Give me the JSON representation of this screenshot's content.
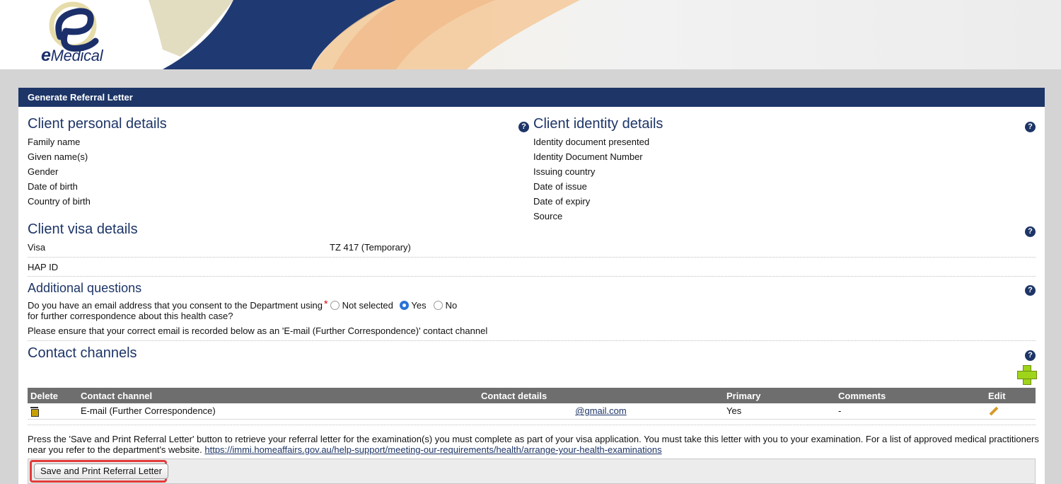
{
  "brand": {
    "logo_text_e": "e",
    "logo_text_rest": "Medical"
  },
  "panel": {
    "title": "Generate Referral Letter"
  },
  "personal": {
    "title": "Client personal details",
    "fields": [
      "Family name",
      "Given name(s)",
      "Gender",
      "Date of birth",
      "Country of birth"
    ]
  },
  "identity": {
    "title": "Client identity details",
    "fields": [
      "Identity document presented",
      "Identity Document Number",
      "Issuing country",
      "Date of issue",
      "Date of expiry",
      "Source"
    ]
  },
  "visa": {
    "title": "Client visa details",
    "visa_label": "Visa",
    "visa_value": "TZ 417 (Temporary)",
    "hap_label": "HAP ID"
  },
  "questions": {
    "title": "Additional questions",
    "question_line1": "Do you have an email address that you consent to the Department using",
    "question_line2": "for further correspondence about this health case?",
    "required_mark": "*",
    "options": [
      "Not selected",
      "Yes",
      "No"
    ],
    "selected": "Yes",
    "note": "Please ensure that your correct email is recorded below as an 'E-mail (Further Correspondence)' contact channel"
  },
  "contact": {
    "title": "Contact channels",
    "headers": [
      "Delete",
      "Contact channel",
      "Contact details",
      "Primary",
      "Comments",
      "Edit"
    ],
    "rows": [
      {
        "channel": "E-mail (Further Correspondence)",
        "details": "@gmail.com",
        "primary": "Yes",
        "comments": "-"
      }
    ]
  },
  "footer": {
    "info_text": "Press the 'Save and Print Referral Letter' button to retrieve your referral letter for the examination(s) you must complete as part of your visa application. You must take this letter with you to your examination. For a list of approved medical practitioners near you refer to the department's website.",
    "link_text": "https://immi.homeaffairs.gov.au/help-support/meeting-our-requirements/health/arrange-your-health-examinations",
    "button_label": "Save and Print Referral Letter"
  },
  "icons": {
    "help": "?",
    "add": "add-contact-icon",
    "delete": "trash-icon",
    "edit": "pencil-icon"
  },
  "colors": {
    "header": "#1d3567",
    "accent_red": "#e23b3b",
    "add_green": "#9ed41a"
  }
}
